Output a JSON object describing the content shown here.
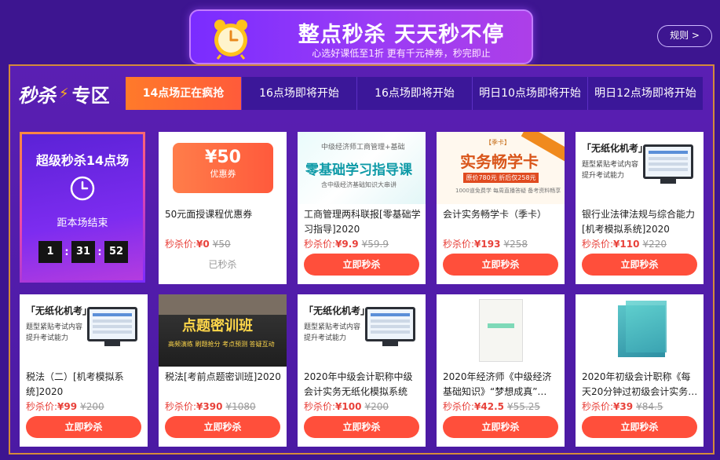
{
  "banner": {
    "title": "整点秒杀 天天秒不停",
    "subtitle": "心选好课低至1折 更有千元神券，秒完即止"
  },
  "rules_label": "规则 >",
  "zone": {
    "logo_main": "秒杀",
    "logo_suffix": "专区"
  },
  "tabs": [
    {
      "label": "14点场正在疯抢",
      "active": true
    },
    {
      "label": "16点场即将开始",
      "active": false
    },
    {
      "label": "16点场即将开始",
      "active": false
    },
    {
      "label": "明日10点场即将开始",
      "active": false
    },
    {
      "label": "明日12点场即将开始",
      "active": false
    }
  ],
  "countdown": {
    "title": "超级秒杀14点场",
    "label": "距本场结束",
    "hours": "1",
    "minutes": "31",
    "seconds": "52"
  },
  "price_label": "秒杀价:",
  "buy_label": "立即秒杀",
  "sold_label": "已秒杀",
  "products": [
    {
      "title": "50元面授课程优惠券",
      "price": "¥0",
      "old_price": "¥50",
      "sold_out": true,
      "thumb": {
        "amount": "¥50",
        "caption": "优惠券"
      }
    },
    {
      "title": "工商管理两科联报[零基础学习指导]2020",
      "price": "¥9.9",
      "old_price": "¥59.9",
      "sold_out": false,
      "thumb": {
        "top": "中级经济师工商管理+基础",
        "big": "零基础学习指导课",
        "bottom": "含中级经济基础知识大串讲"
      }
    },
    {
      "title": "会计实务畅学卡（季卡）",
      "price": "¥193",
      "old_price": "¥258",
      "sold_out": false,
      "thumb": {
        "tag": "【季卡】",
        "big": "实务畅学卡",
        "bar": "原价780元 折后仅258元",
        "note": "1000道免费学 每周直播答疑 备考资料畅享"
      }
    },
    {
      "title": "银行业法律法规与综合能力[机考模拟系统]2020",
      "price": "¥110",
      "old_price": "¥220",
      "sold_out": false,
      "thumb": {
        "heading": "「无纸化机考」",
        "line1": "题型紧贴考试内容",
        "line2": "提升考试能力"
      }
    },
    {
      "title": "税法（二）[机考模拟系统]2020",
      "price": "¥99",
      "old_price": "¥200",
      "sold_out": false,
      "thumb": {
        "heading": "「无纸化机考」",
        "line1": "题型紧贴考试内容",
        "line2": "提升考试能力"
      }
    },
    {
      "title": "税法[考前点题密训班]2020",
      "price": "¥390",
      "old_price": "¥1080",
      "sold_out": false,
      "thumb": {
        "big": "点题密训班",
        "chips": "高频演练 刷题抢分 考点预测 答疑互动"
      }
    },
    {
      "title": "2020年中级会计职称中级会计实务无纸化模拟系统",
      "price": "¥100",
      "old_price": "¥200",
      "sold_out": false,
      "thumb": {
        "heading": "「无纸化机考」",
        "line1": "题型紧贴考试内容",
        "line2": "提升考试能力"
      }
    },
    {
      "title": "2020年经济师《中级经济基础知识》“梦想成真”…",
      "price": "¥42.5",
      "old_price": "¥55.25",
      "sold_out": false,
      "thumb": {}
    },
    {
      "title": "2020年初级会计职称《每天20分钟过初级会计实务…",
      "price": "¥39",
      "old_price": "¥84.5",
      "sold_out": false,
      "thumb": {}
    }
  ]
}
